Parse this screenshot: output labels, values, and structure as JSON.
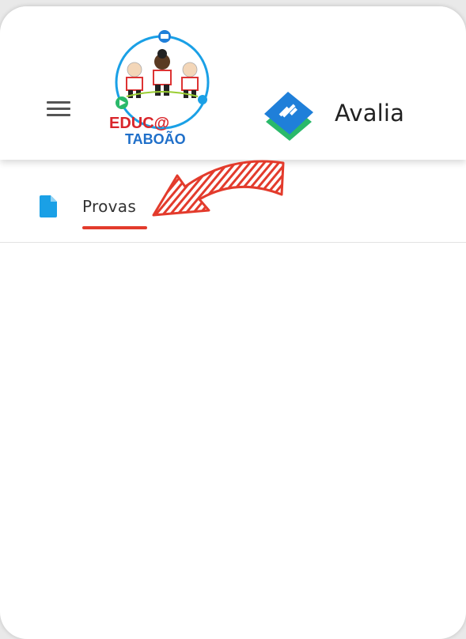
{
  "header": {
    "app_title": "Avalia",
    "logo_text_line1": "EDUC@",
    "logo_text_line2": "TABOÃO"
  },
  "nav": {
    "items": [
      {
        "label": "Provas",
        "icon": "document-icon"
      }
    ]
  },
  "colors": {
    "annotation_red": "#e33b2c",
    "doc_icon_blue": "#1aa0e6",
    "brand_blue": "#1f7fd9",
    "brand_green": "#2ab96a"
  }
}
